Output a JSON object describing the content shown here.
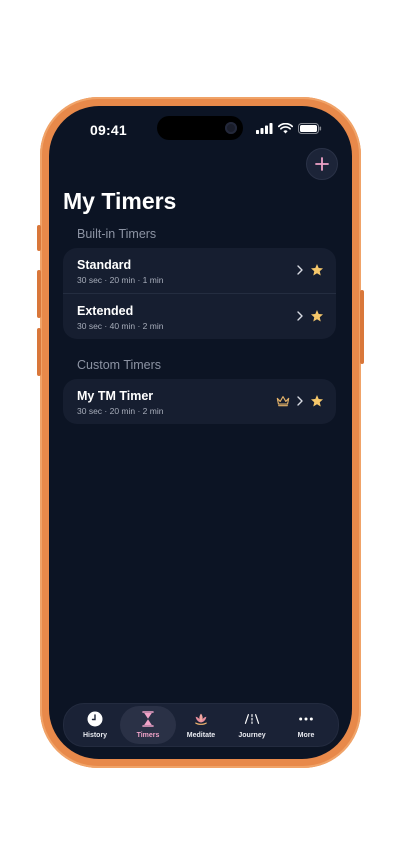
{
  "status_bar": {
    "time": "09:41"
  },
  "header": {
    "title": "My Timers",
    "add_icon": "plus-icon"
  },
  "sections": {
    "builtin": {
      "label": "Built-in Timers",
      "items": [
        {
          "title": "Standard",
          "subtitle": "30 sec · 20 min · 1 min",
          "favorite": true
        },
        {
          "title": "Extended",
          "subtitle": "30 sec · 40 min · 2 min",
          "favorite": true
        }
      ]
    },
    "custom": {
      "label": "Custom Timers",
      "items": [
        {
          "title": "My TM Timer",
          "subtitle": "30 sec · 20 min · 2 min",
          "premium": true,
          "favorite": true
        }
      ]
    }
  },
  "tabbar": {
    "tabs": [
      {
        "label": "History",
        "icon": "clock-icon"
      },
      {
        "label": "Timers",
        "icon": "hourglass-icon",
        "active": true
      },
      {
        "label": "Meditate",
        "icon": "lotus-icon"
      },
      {
        "label": "Journey",
        "icon": "road-icon"
      },
      {
        "label": "More",
        "icon": "ellipsis-icon"
      }
    ]
  },
  "colors": {
    "background": "#0c1424",
    "card": "#161e30",
    "star": "#f5c76a",
    "crown": "#e7b56a",
    "active_tab": "#f0a3c8",
    "phone_frame": "#e8894a"
  }
}
